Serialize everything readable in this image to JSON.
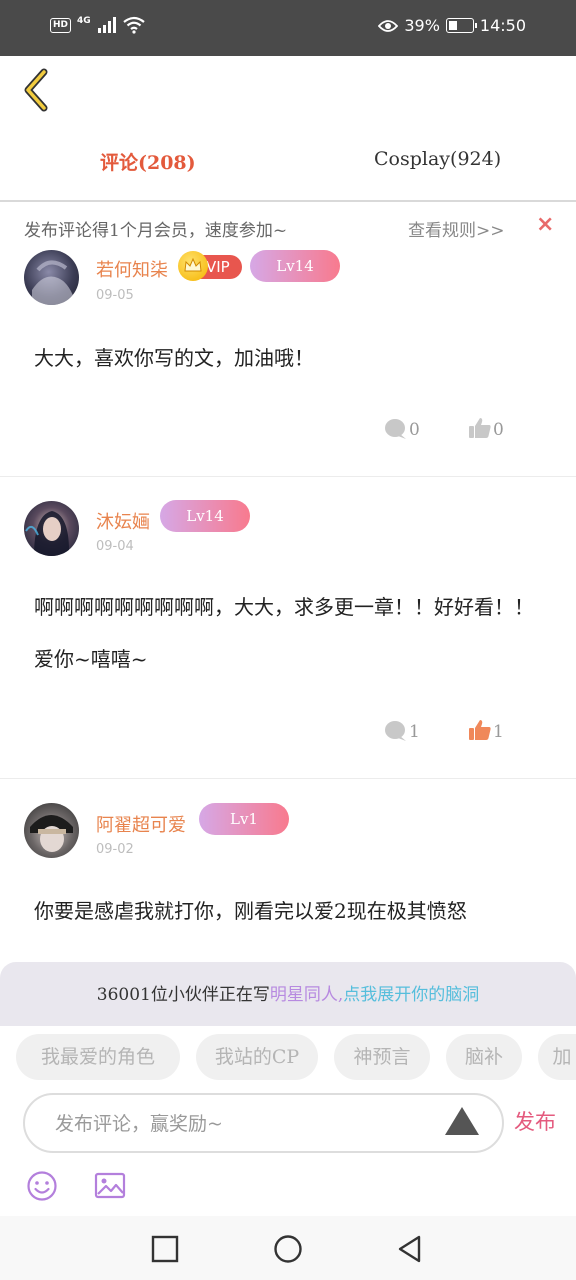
{
  "status_bar": {
    "hd": "HD",
    "network": "4G",
    "battery_text": "39%",
    "battery_level": 0.39,
    "time": "14:50"
  },
  "header": {
    "back_icon": "chevron-left-icon"
  },
  "tabs": [
    {
      "label": "评论(208)",
      "active": true
    },
    {
      "label": "Cosplay(924)",
      "active": false
    }
  ],
  "notice": {
    "text": "发布评论得1个月会员，速度参加~",
    "rules": "查看规则>>",
    "close": "×"
  },
  "comments": [
    {
      "username": "若何知柒",
      "vip": true,
      "vip_label": "VIP",
      "level": "Lv14",
      "date": "09-05",
      "text": "大大，喜欢你写的文，加油哦！",
      "reply_count": "0",
      "like_count": "0",
      "liked": false
    },
    {
      "username": "沐妘婳",
      "vip": false,
      "level": "Lv14",
      "date": "09-04",
      "text": "啊啊啊啊啊啊啊啊啊，大大，求多更一章！！好好看！！爱你~嘻嘻~",
      "reply_count": "1",
      "like_count": "1",
      "liked": true
    },
    {
      "username": "阿翟超可爱",
      "vip": false,
      "level": "Lv1",
      "date": "09-02",
      "text": "你要是感虐我就打你，刚看完以爱2现在极其愤怒"
    }
  ],
  "prompt": {
    "count_text": "36001位小伙伴正在写",
    "topic": "明星同人,",
    "cta": "点我展开你的脑洞"
  },
  "chips": [
    "我最爱的角色",
    "我站的CP",
    "神预言",
    "脑补",
    "加"
  ],
  "composer": {
    "placeholder": "发布评论，赢奖励~",
    "publish_label": "发布"
  },
  "colors": {
    "accent_orange": "#e35a3c",
    "username": "#e8844e",
    "like_active": "#f0885a",
    "publish": "#e45a7e",
    "level_gradient_start": "#d6a8e6",
    "level_gradient_end": "#f87a8e"
  }
}
